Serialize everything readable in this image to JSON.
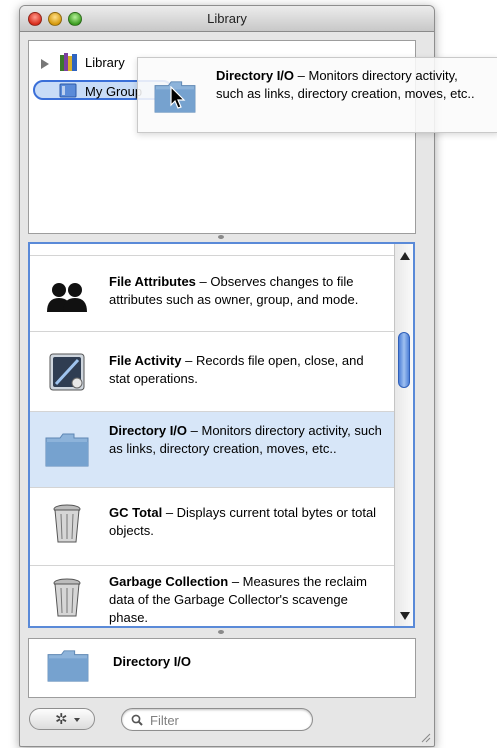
{
  "window": {
    "title": "Library"
  },
  "source_list": {
    "library_label": "Library",
    "group_label": "My Group"
  },
  "instruments": [
    {
      "name": "File Attributes",
      "desc": " – Observes changes to file attributes such as owner, group, and mode.",
      "icon": "users-icon",
      "selected": false
    },
    {
      "name": "File Activity",
      "desc": " – Records file open, close, and stat operations.",
      "icon": "disk-activity-icon",
      "selected": false
    },
    {
      "name": "Directory I/O",
      "desc": " – Monitors directory activity, such as links, directory creation, moves, etc..",
      "icon": "folder-icon",
      "selected": true
    },
    {
      "name": "GC Total",
      "desc": " – Displays current total bytes or total objects.",
      "icon": "trash-icon",
      "selected": false
    },
    {
      "name": "Garbage Collection",
      "desc": " – Measures the reclaim data of the Garbage Collector's scavenge phase.",
      "icon": "trash-icon",
      "selected": false
    }
  ],
  "detail": {
    "title": "Directory I/O"
  },
  "drag_ghost": {
    "name": "Directory I/O",
    "desc": " – Monitors directory activity, such as links, directory creation, moves, etc.."
  },
  "filter": {
    "placeholder": "Filter"
  },
  "colors": {
    "selection": "#d7e6f8",
    "focus_ring": "#5a8ad8",
    "folder": "#7fa8d2"
  }
}
